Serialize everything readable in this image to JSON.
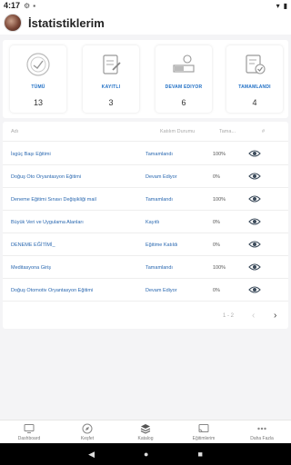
{
  "status_bar": {
    "time": "4:17"
  },
  "header": {
    "title": "İstatistiklerim"
  },
  "stats": [
    {
      "label": "TÜMÜ",
      "value": "13",
      "icon": "certificate-icon"
    },
    {
      "label": "KAYITLI",
      "value": "3",
      "icon": "edit-document-icon"
    },
    {
      "label": "DEVAM EDIYOR",
      "value": "6",
      "icon": "progress-icon"
    },
    {
      "label": "TAMAMLANDI",
      "value": "4",
      "icon": "completed-document-icon"
    }
  ],
  "table": {
    "columns": {
      "name": "Adı",
      "status": "Katılım Durumu",
      "completion": "Tama...",
      "index": "#"
    },
    "rows": [
      {
        "name": "İsgüç Başı Eğitimi",
        "status": "Tamamlandı",
        "completion": "100%"
      },
      {
        "name": "Doğuş Oto Oryantasyon Eğitimi",
        "status": "Devam Ediyor",
        "completion": "0%"
      },
      {
        "name": "Deneme Eğitimi Sınavı Değişikliği mail",
        "status": "Tamamlandı",
        "completion": "100%"
      },
      {
        "name": "Büyük Veri ve Uygulama Alanları",
        "status": "Kayıtlı",
        "completion": "0%"
      },
      {
        "name": "DENEME EĞİTİMİ_",
        "status": "Eğitime Katıldı",
        "completion": "0%"
      },
      {
        "name": "Meditasyona Giriş",
        "status": "Tamamlandı",
        "completion": "100%"
      },
      {
        "name": "Doğuş Otomotiv Oryantasyon Eğitimi",
        "status": "Devam Ediyor",
        "completion": "0%"
      }
    ],
    "pagination": {
      "range": "1 - 2"
    }
  },
  "bottom_nav": [
    {
      "label": "Dashboard",
      "icon": "monitor-icon"
    },
    {
      "label": "Keşfet",
      "icon": "compass-icon"
    },
    {
      "label": "Katalog",
      "icon": "layers-icon"
    },
    {
      "label": "Eğitimlerim",
      "icon": "cast-icon"
    },
    {
      "label": "Daha Fazla",
      "icon": "more-icon"
    }
  ],
  "colors": {
    "accent": "#1f6fc5",
    "link": "#2a68b0"
  }
}
